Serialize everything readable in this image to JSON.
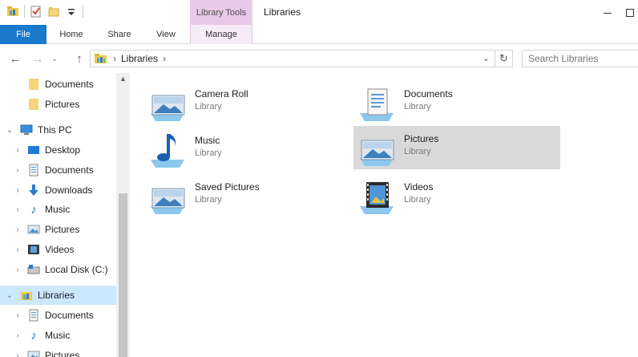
{
  "titlebar": {
    "title": "Libraries",
    "context_tab_group": "Library Tools",
    "icons": [
      "libraries-folder-icon",
      "properties-icon",
      "new-folder-icon",
      "customize-qat-icon"
    ]
  },
  "ribbon": {
    "tabs": [
      {
        "label": "File"
      },
      {
        "label": "Home"
      },
      {
        "label": "Share"
      },
      {
        "label": "View"
      },
      {
        "label": "Manage"
      }
    ]
  },
  "address": {
    "breadcrumb": "Libraries",
    "search_placeholder": "Search Libraries"
  },
  "nav_pane": {
    "items": [
      {
        "label": "Documents",
        "icon": "folder-icon"
      },
      {
        "label": "Pictures",
        "icon": "folder-icon"
      },
      {
        "label": "This PC",
        "icon": "computer-icon"
      },
      {
        "label": "Desktop",
        "icon": "desktop-icon"
      },
      {
        "label": "Documents",
        "icon": "documents-icon"
      },
      {
        "label": "Downloads",
        "icon": "download-icon"
      },
      {
        "label": "Music",
        "icon": "music-icon"
      },
      {
        "label": "Pictures",
        "icon": "pictures-icon"
      },
      {
        "label": "Videos",
        "icon": "videos-icon"
      },
      {
        "label": "Local Disk (C:)",
        "icon": "drive-icon"
      },
      {
        "label": "Libraries",
        "icon": "libraries-icon"
      },
      {
        "label": "Documents",
        "icon": "documents-icon"
      },
      {
        "label": "Music",
        "icon": "music-icon"
      },
      {
        "label": "Pictures",
        "icon": "pictures-icon"
      }
    ]
  },
  "libraries": [
    {
      "name": "Camera Roll",
      "type": "Library",
      "icon": "camera-roll-library-icon"
    },
    {
      "name": "Documents",
      "type": "Library",
      "icon": "documents-library-icon"
    },
    {
      "name": "Music",
      "type": "Library",
      "icon": "music-library-icon"
    },
    {
      "name": "Pictures",
      "type": "Library",
      "icon": "pictures-library-icon"
    },
    {
      "name": "Saved Pictures",
      "type": "Library",
      "icon": "saved-pictures-library-icon"
    },
    {
      "name": "Videos",
      "type": "Library",
      "icon": "videos-library-icon"
    }
  ],
  "colors": {
    "file_tab": "#1979ca",
    "context_tab": "#e9c9e8",
    "nav_selected": "#cce8ff",
    "item_selected": "#d9d9d9"
  }
}
